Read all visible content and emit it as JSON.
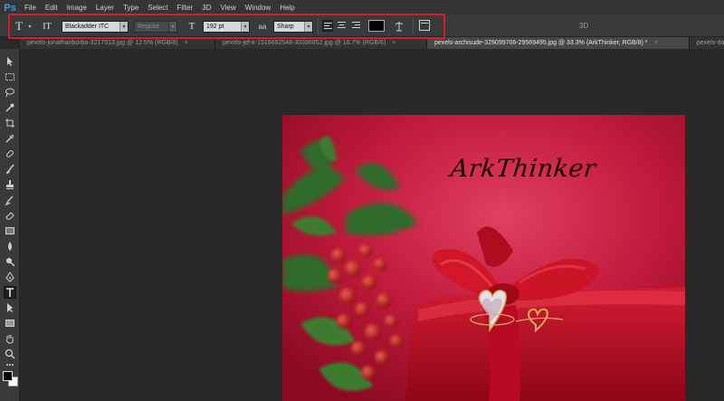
{
  "app": {
    "logo": "Ps"
  },
  "menu": [
    "File",
    "Edit",
    "Image",
    "Layer",
    "Type",
    "Select",
    "Filter",
    "3D",
    "View",
    "Window",
    "Help"
  ],
  "options_bar": {
    "tool_icon": "T",
    "orient_icon": "IT",
    "font_family": "Blackadder ITC",
    "font_style": "Regular",
    "size_icon": "T",
    "font_size": "192 pt",
    "aa_icon": "aa",
    "antialias": "Sharp",
    "text_color": "#000000",
    "label_3d": "3D"
  },
  "tabs": [
    {
      "label": "pexels-jonathanborba-3217513.jpg @ 12.5% (RGB/8)",
      "close": "×",
      "active": false
    },
    {
      "label": "pexels-jef-k-1518692548-30396852.jpg @ 16.7% (RGB/8)",
      "close": "×",
      "active": false
    },
    {
      "label": "pexels-archisude-329099706-29569495.jpg @ 33.3% (ArkThinker, RGB/8) *",
      "close": "×",
      "active": true
    },
    {
      "label": "pexels-da",
      "close": "",
      "active": false
    }
  ],
  "canvas": {
    "text_layer": "ArkThinker"
  },
  "colors": {
    "highlight": "#d21f2b",
    "accent": "#3c9bef",
    "foreground": "#000000",
    "background": "#ffffff"
  }
}
